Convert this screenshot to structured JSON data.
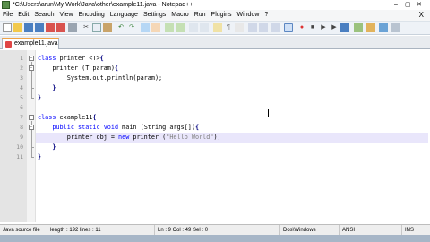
{
  "window": {
    "title": "*C:\\Users\\arun\\My Work\\Java\\other\\example11.java - Notepad++",
    "minimize": "–",
    "maximize": "▢",
    "close": "✕",
    "menu_close": "X"
  },
  "menu": [
    "File",
    "Edit",
    "Search",
    "View",
    "Encoding",
    "Language",
    "Settings",
    "Macro",
    "Run",
    "Plugins",
    "Window",
    "?"
  ],
  "tab": {
    "label": "example11.java"
  },
  "lines": [
    {
      "n": "1",
      "text": "class printer <T>{"
    },
    {
      "n": "2",
      "text": "    printer (T param){"
    },
    {
      "n": "3",
      "text": "        System.out.println(param);"
    },
    {
      "n": "4",
      "text": "    }"
    },
    {
      "n": "5",
      "text": "}"
    },
    {
      "n": "6",
      "text": ""
    },
    {
      "n": "7",
      "text": "class example11{"
    },
    {
      "n": "8",
      "text": "    public static void main (String args[]){"
    },
    {
      "n": "9",
      "text": "        printer obj = new printer (\"Hello World\");"
    },
    {
      "n": "10",
      "text": "    }"
    },
    {
      "n": "11",
      "text": "}"
    }
  ],
  "status": {
    "file_type": "Java source file",
    "length_lines": "length : 192    lines : 11",
    "position": "Ln : 9    Col : 49    Sel : 0",
    "eol": "Dos\\Windows",
    "encoding": "ANSI",
    "mode": "INS"
  }
}
